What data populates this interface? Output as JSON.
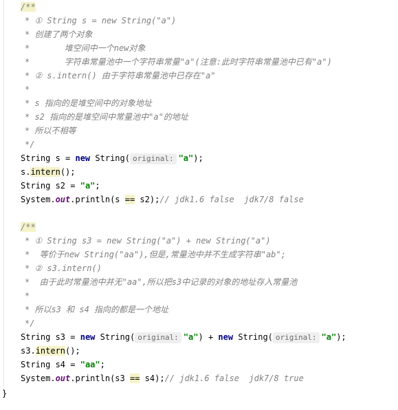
{
  "comment1": {
    "open": "/**",
    "l1": "* ① String s = new String(\"a\")",
    "l2": "* 创建了两个对象",
    "l3": "*       堆空间中一个new对象",
    "l4": "*       字符串常量池中一个字符串常量\"a\"(注意:此时字符串常量池中已有\"a\")",
    "l5": "* ② s.intern() 由于字符串常量池中已存在\"a\"",
    "l6": "*",
    "l7": "* s 指向的是堆空间中的对象地址",
    "l8": "* s2 指向的是堆空间中常量池中\"a\"的地址",
    "l9": "* 所以不相等",
    "close": "*/"
  },
  "code1": {
    "decl_type": "String",
    "decl_var": " s = ",
    "kw_new": "new",
    "ctor": " String(",
    "hint_label": "original:",
    "arg": "\"a\"",
    "end": ");",
    "intern_obj": "s.",
    "intern_method": "intern",
    "intern_end": "();",
    "s2_type": "String",
    "s2_rest": " s2 = ",
    "s2_val": "\"a\"",
    "s2_end": ";",
    "print_pre": "System.",
    "print_field": "out",
    "print_mid": ".println(s ",
    "print_op": "==",
    "print_post": " s2);",
    "print_comment": "// jdk1.6 false  jdk7/8 false"
  },
  "comment2": {
    "open": "/**",
    "l1": "* ① String s3 = new String(\"a\") + new String(\"a\")",
    "l2": "*  等价于new String(\"aa\"),但是,常量池中并不生成字符串\"ab\";",
    "l3": "* ② s3.intern()",
    "l4": "*  由于此时常量池中并无\"aa\",所以把s3中记录的对象的地址存入常量池",
    "l5": "*",
    "l6": "* 所以s3 和 s4 指向的都是一个地址",
    "close": "*/"
  },
  "code2": {
    "decl_type": "String",
    "decl_var": " s3 = ",
    "kw_new": "new",
    "ctor": " String(",
    "hint_label": "original:",
    "arg": "\"a\"",
    "plus": ") + ",
    "kw_new2": "new",
    "ctor2": " String(",
    "hint_label2": "original:",
    "arg2": "\"a\"",
    "end": ");",
    "intern_obj": "s3.",
    "intern_method": "intern",
    "intern_end": "();",
    "s4_type": "String",
    "s4_rest": " s4 = ",
    "s4_val": "\"aa\"",
    "s4_end": ";",
    "print_pre": "System.",
    "print_field": "out",
    "print_mid": ".println(s3 ",
    "print_op": "==",
    "print_post": " s4);",
    "print_comment": "// jdk1.6 false  jdk7/8 true"
  },
  "closing_brace": "}"
}
